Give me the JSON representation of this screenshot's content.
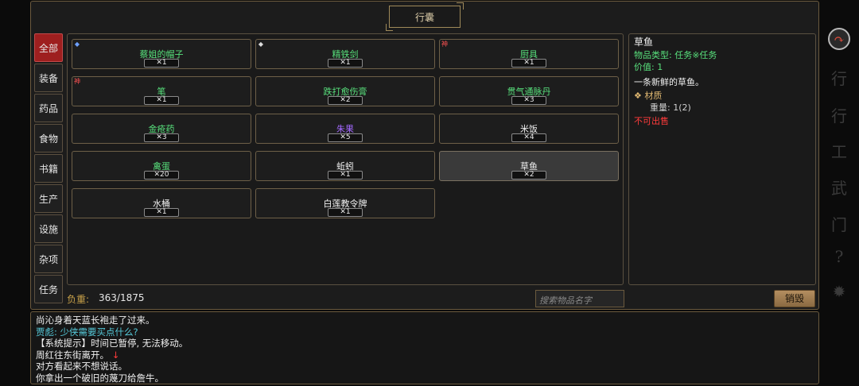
{
  "title": "行囊",
  "categories": [
    "全部",
    "装备",
    "药品",
    "食物",
    "书籍",
    "生产",
    "设施",
    "杂项",
    "任务"
  ],
  "items": [
    {
      "name": "蔡姐的帽子",
      "qty": "✕1",
      "color": "#58e07c",
      "badge": "◆",
      "badge_class": "badge-blue"
    },
    {
      "name": "精铁剑",
      "qty": "✕1",
      "color": "#58e07c",
      "badge": "◆",
      "badge_class": "badge-white"
    },
    {
      "name": "厨具",
      "qty": "✕1",
      "color": "#58e07c",
      "badge": "神",
      "badge_class": "badge-red"
    },
    {
      "name": "笔",
      "qty": "✕1",
      "color": "#58e07c",
      "badge": "神",
      "badge_class": "badge-red"
    },
    {
      "name": "跌打愈伤膏",
      "qty": "✕2",
      "color": "#58e07c",
      "badge": "",
      "badge_class": ""
    },
    {
      "name": "贯气通脉丹",
      "qty": "✕3",
      "color": "#58e07c",
      "badge": "",
      "badge_class": ""
    },
    {
      "name": "金疮药",
      "qty": "✕3",
      "color": "#58e07c",
      "badge": "",
      "badge_class": ""
    },
    {
      "name": "朱果",
      "qty": "✕5",
      "color": "#a368ff",
      "badge": "",
      "badge_class": ""
    },
    {
      "name": "米饭",
      "qty": "✕4",
      "color": "#f0f0f0",
      "badge": "",
      "badge_class": ""
    },
    {
      "name": "禽蛋",
      "qty": "✕20",
      "color": "#58e07c",
      "badge": "",
      "badge_class": ""
    },
    {
      "name": "蚯蚓",
      "qty": "✕1",
      "color": "#f0f0f0",
      "badge": "",
      "badge_class": ""
    },
    {
      "name": "草鱼",
      "qty": "✕2",
      "color": "#f0f0f0",
      "badge": "",
      "badge_class": "",
      "selected": true
    },
    {
      "name": "水桶",
      "qty": "✕1",
      "color": "#f0f0f0",
      "badge": "",
      "badge_class": ""
    },
    {
      "name": "白莲教令牌",
      "qty": "✕1",
      "color": "#f0f0f0",
      "badge": "",
      "badge_class": ""
    }
  ],
  "weight": {
    "label": "负重:",
    "value": "363/1875"
  },
  "search": {
    "placeholder": "搜索物品名字"
  },
  "destroy_label": "销毁",
  "detail": {
    "name": "草鱼",
    "type": "物品类型: 任务※任务",
    "value": "价值: 1",
    "desc": "一条新鲜的草鱼。",
    "material": "❖ 材质",
    "weight": "重量: 1(2)",
    "unsellable": "不可出售"
  },
  "log": [
    {
      "text": "尚沁身着天蓝长袍走了过来。",
      "cls": ""
    },
    {
      "text": "贾彪: 少侠需要买点什么?",
      "cls": "cyan"
    },
    {
      "text": "【系统提示】时间已暂停, 无法移动。",
      "cls": ""
    },
    {
      "text": "周红往东街离开。",
      "cls": "",
      "arrow": "↓"
    },
    {
      "text": "对方看起来不想说话。",
      "cls": ""
    },
    {
      "text": "你拿出一个破旧的蔑刀给詹牛。",
      "cls": ""
    }
  ],
  "rail": [
    {
      "name": "action-toggle-icon",
      "glyph": "↷",
      "active": true
    },
    {
      "name": "action-icon",
      "glyph": "行"
    },
    {
      "name": "bag-icon",
      "glyph": "行"
    },
    {
      "name": "work-icon",
      "glyph": "工"
    },
    {
      "name": "martial-icon",
      "glyph": "武"
    },
    {
      "name": "sect-icon",
      "glyph": "门"
    },
    {
      "name": "help-icon",
      "glyph": "?"
    },
    {
      "name": "settings-icon",
      "glyph": "✹"
    }
  ]
}
